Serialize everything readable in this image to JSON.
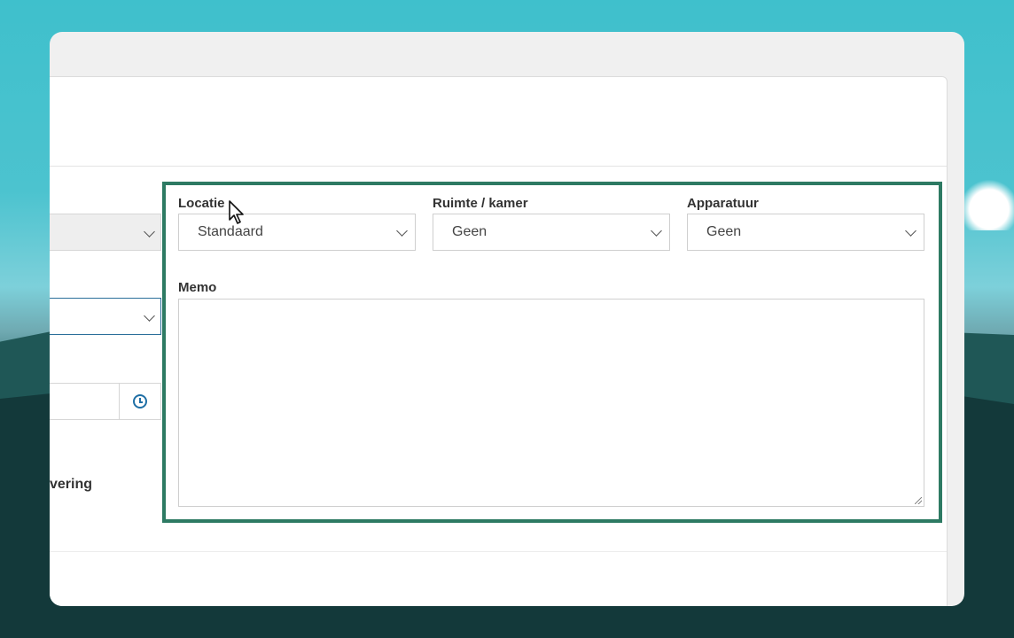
{
  "background": {
    "accent": "#2d7a63"
  },
  "left_column": {
    "partial_label": "vering"
  },
  "panel": {
    "locatie": {
      "label": "Locatie",
      "value": "Standaard"
    },
    "ruimte": {
      "label": "Ruimte / kamer",
      "value": "Geen"
    },
    "apparatuur": {
      "label": "Apparatuur",
      "value": "Geen"
    },
    "memo": {
      "label": "Memo",
      "value": ""
    }
  },
  "icons": [
    "chevron-down-icon",
    "clock-icon",
    "resize-grip-icon",
    "mouse-cursor-icon"
  ]
}
